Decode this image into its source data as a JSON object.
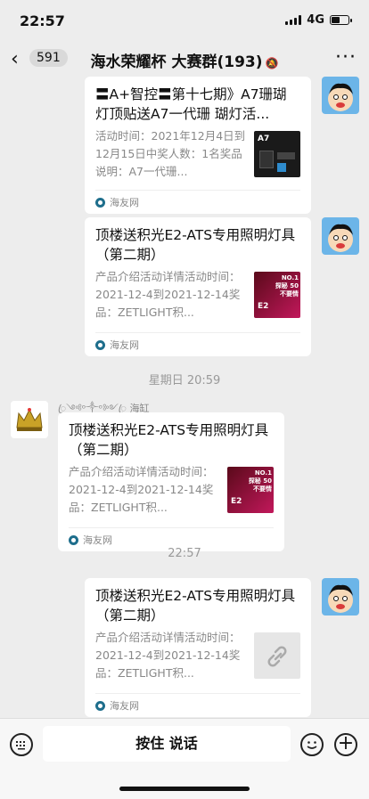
{
  "status": {
    "time": "22:57",
    "network": "4G"
  },
  "nav": {
    "back_count": "591",
    "title": "海水荣耀杯 大赛群(193)"
  },
  "messages": [
    {
      "title": "〓A+智控〓第十七期》A7珊瑚灯顶贴送A7一代珊 瑚灯活...",
      "desc": "活动时间：2021年12月4日到12月15日中奖人数：1名奖品说明：A7一代珊...",
      "source": "海友网",
      "thumb_label": "A7"
    },
    {
      "title": "顶楼送积光E2-ATS专用照明灯具（第二期）",
      "desc": "产品介绍活动详情活动时间：2021-12-4到2021-12-14奖品：ZETLIGHT积...",
      "source": "海友网",
      "thumb_label": "NO.1 探秘 50不要情"
    },
    {
      "title": "顶楼送积光E2-ATS专用照明灯具（第二期）",
      "desc": "产品介绍活动详情活动时间：2021-12-4到2021-12-14奖品：ZETLIGHT积...",
      "source": "海友网",
      "thumb_label": "NO.1 探秘 50不要情",
      "sender": "ꦿ༺ᵒ༒ᵒ༻ꦿ 海缸"
    },
    {
      "title": "顶楼送积光E2-ATS专用照明灯具（第二期）",
      "desc": "产品介绍活动详情活动时间：2021-12-4到2021-12-14奖品：ZETLIGHT积...",
      "source": "海友网"
    }
  ],
  "timestamps": {
    "t1": "星期日 20:59",
    "t2": "22:57"
  },
  "input": {
    "hold_label": "按住 说话"
  }
}
